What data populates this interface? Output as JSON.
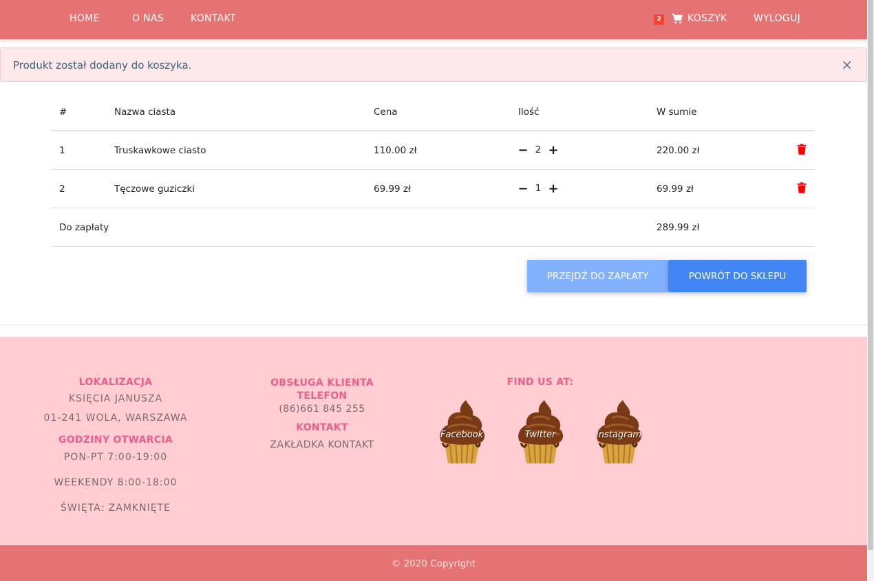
{
  "navbar": {
    "links": [
      "HOME",
      "O NAS",
      "KONTAKT"
    ],
    "cart_count": "2",
    "cart_label": "KOSZYK",
    "logout_label": "WYLOGUJ",
    "cart_icon": "shopping-cart-icon",
    "color": "#e57373"
  },
  "alert": {
    "message": "Produkt został dodany do koszyka.",
    "close_symbol": "×"
  },
  "cart": {
    "headers": [
      "#",
      "Nazwa ciasta",
      "Cena",
      "Ilość",
      "W sumie"
    ],
    "rows": [
      {
        "num": "1",
        "name": "Truskawkowe ciasto",
        "price": "110.00 zł",
        "qty": "2",
        "sum": "220.00 zł"
      },
      {
        "num": "2",
        "name": "Tęczowe guziczki",
        "price": "69.99 zł",
        "qty": "1",
        "sum": "69.99 zł"
      }
    ],
    "total_label": "Do zapłaty",
    "total_value": "289.99 zł",
    "minus_symbol": "−",
    "plus_symbol": "+",
    "delete_icon": "trash-icon",
    "delete_color": "#ff0000"
  },
  "actions": {
    "pay_label": "PRZEJDŹ DO ZAPŁATY",
    "back_label": "POWRÓT DO SKLEPU",
    "pay_color": "#82b1ff",
    "back_color": "#4285f4"
  },
  "footer": {
    "location_heading": "LOKALIZACJA",
    "address_line1": "KSIĘCIA JANUSZA",
    "address_line2": "01-241 WOLA, WARSZAWA",
    "hours_heading": "GODZINY OTWARCIA",
    "hours_weekdays": "PON-PT 7:00-19:00",
    "hours_weekend": "WEEKENDY 8:00-18:00",
    "hours_holidays": "ŚWIĘTA: ZAMKNIĘTE",
    "support_heading": "OBSŁUGA KLIENTA TELEFON",
    "phone": "(86)661 845 255",
    "contact_heading": "KONTAKT",
    "contact_link": "ZAKŁADKA KONTAKT",
    "find_us_heading": "FIND US AT:",
    "social": [
      "Facebook",
      "Twitter",
      "Instagram"
    ],
    "social_icon": "cupcake-icon",
    "background": "#ffcdd2",
    "heading_color": "#ec5f8b"
  },
  "copyright": "© 2020 Copyright"
}
